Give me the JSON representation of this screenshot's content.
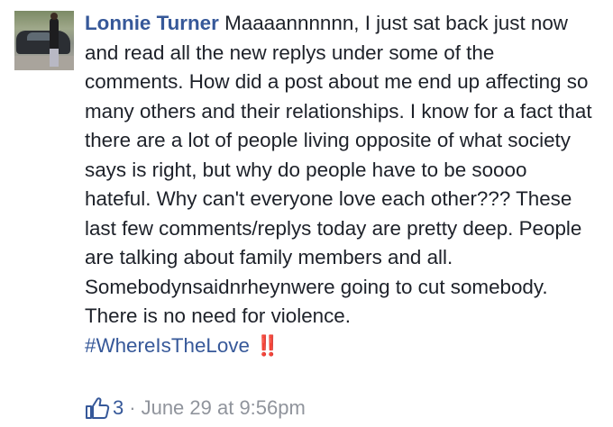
{
  "comment": {
    "author": "Lonnie Turner",
    "text": "Maaaannnnnn, I just sat back just now and read all the new replys under some of the comments. How did a post about me end up affecting so many others and their relationships. I know for a fact that there are a lot of people living opposite of what society says is right, but why do people have to be soooo hateful. Why can't everyone love each other??? These last few comments/replys today are pretty deep. People are talking about family members and all. Somebodynsaidnrheynwere going to cut somebody. There is no need for violence.",
    "hashtag": "#WhereIsTheLove",
    "emoji": "‼️",
    "like_count": "3",
    "separator": "·",
    "timestamp": "June 29 at 9:56pm"
  },
  "colors": {
    "link_blue": "#365899",
    "text": "#1d2129",
    "meta_gray": "#90949c",
    "emoji_red": "#d01f2c"
  },
  "icons": {
    "like": "thumbs-up-icon"
  }
}
